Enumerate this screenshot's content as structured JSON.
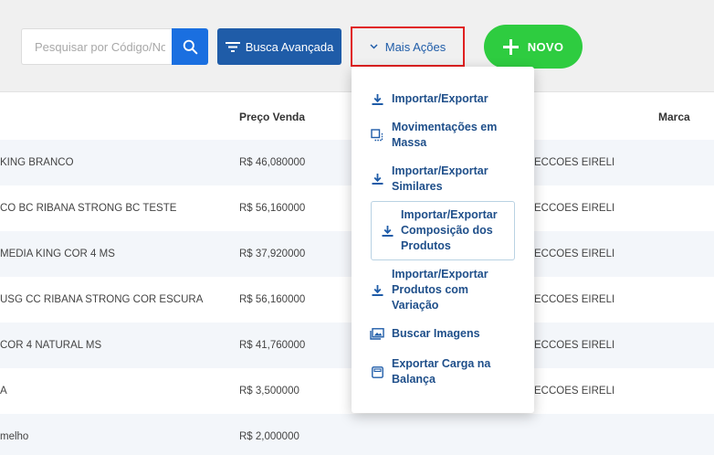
{
  "toolbar": {
    "search_placeholder": "Pesquisar por Código/Nome",
    "advanced_search_label": "Busca Avançada",
    "more_actions_label": "Mais Ações",
    "new_label": "NOVO"
  },
  "table": {
    "headers": {
      "price": "Preço Venda",
      "brand": "Marca"
    },
    "rows": [
      {
        "description": "KING BRANCO",
        "price": "R$ 46,080000",
        "supplier": "ECCOES EIRELI"
      },
      {
        "description": "CO BC RIBANA STRONG BC TESTE",
        "price": "R$ 56,160000",
        "supplier": "ECCOES EIRELI"
      },
      {
        "description": "MEDIA KING COR 4 MS",
        "price": "R$ 37,920000",
        "supplier": "ECCOES EIRELI"
      },
      {
        "description": "USG CC RIBANA STRONG COR ESCURA",
        "price": "R$ 56,160000",
        "supplier": "ECCOES EIRELI"
      },
      {
        "description": "COR 4 NATURAL MS",
        "price": "R$ 41,760000",
        "supplier": "ECCOES EIRELI"
      },
      {
        "description": "A",
        "price": "R$ 3,500000",
        "supplier": "ECCOES EIRELI"
      },
      {
        "description": "melho",
        "price": "R$ 2,000000",
        "supplier": ""
      }
    ]
  },
  "menu": {
    "items": [
      {
        "label": "Importar/Exportar",
        "icon": "download-icon"
      },
      {
        "label": "Movimentações em Massa",
        "icon": "copy-icon"
      },
      {
        "label": "Importar/Exportar Similares",
        "icon": "download-icon"
      },
      {
        "label": "Importar/Exportar Composição dos Produtos",
        "icon": "download-icon"
      },
      {
        "label": "Importar/Exportar Produtos com Variação",
        "icon": "download-icon"
      },
      {
        "label": "Buscar Imagens",
        "icon": "images-icon"
      },
      {
        "label": "Exportar Carga na Balança",
        "icon": "scale-icon"
      }
    ]
  },
  "colors": {
    "primary_blue": "#1a6fe0",
    "dark_blue": "#1f5ca8",
    "menu_text": "#1f4f8a",
    "new_green": "#2ecc40",
    "highlight_red": "#e02020"
  }
}
